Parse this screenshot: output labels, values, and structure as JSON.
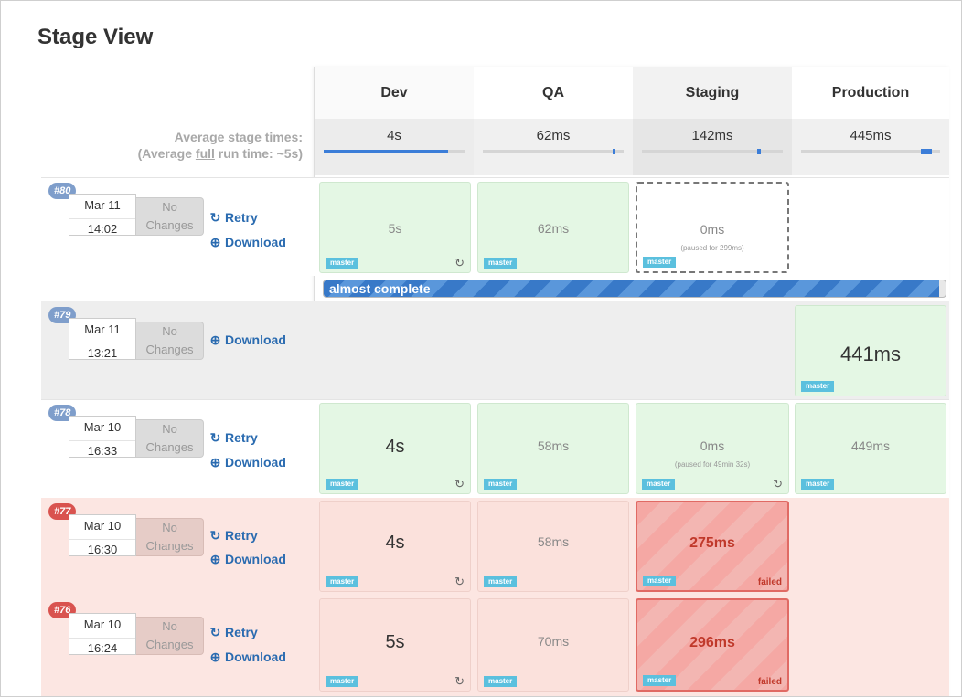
{
  "title": "Stage View",
  "stages": [
    "Dev",
    "QA",
    "Staging",
    "Production"
  ],
  "average": {
    "label_line1": "Average stage times:",
    "label_prefix": "(Average ",
    "label_full": "full",
    "label_suffix": " run time: ~5s)",
    "times": [
      "4s",
      "62ms",
      "142ms",
      "445ms"
    ],
    "levels": [
      0.88,
      0.93,
      0.83,
      0.9
    ]
  },
  "labels": {
    "no": "No",
    "changes": "Changes",
    "retry": "Retry",
    "download": "Download",
    "branch": "master",
    "failed": "failed"
  },
  "progress": {
    "label": "almost complete",
    "fraction": 0.99
  },
  "runs": [
    {
      "id": "#80",
      "date": "Mar 11",
      "time": "14:02",
      "cells": [
        {
          "v": "5s"
        },
        {
          "v": "62ms"
        },
        {
          "v": "0ms",
          "sub": "(paused for 299ms)"
        },
        null
      ]
    },
    {
      "id": "#79",
      "date": "Mar 11",
      "time": "13:21",
      "cells": [
        null,
        null,
        null,
        {
          "v": "441ms"
        }
      ]
    },
    {
      "id": "#78",
      "date": "Mar 10",
      "time": "16:33",
      "cells": [
        {
          "v": "4s"
        },
        {
          "v": "58ms"
        },
        {
          "v": "0ms",
          "sub": "(paused for 49min 32s)"
        },
        {
          "v": "449ms"
        }
      ]
    },
    {
      "id": "#77",
      "date": "Mar 10",
      "time": "16:30",
      "cells": [
        {
          "v": "4s"
        },
        {
          "v": "58ms"
        },
        {
          "v": "275ms"
        },
        null
      ]
    },
    {
      "id": "#76",
      "date": "Mar 10",
      "time": "16:24",
      "cells": [
        {
          "v": "5s"
        },
        {
          "v": "70ms"
        },
        {
          "v": "296ms"
        },
        null
      ]
    }
  ]
}
